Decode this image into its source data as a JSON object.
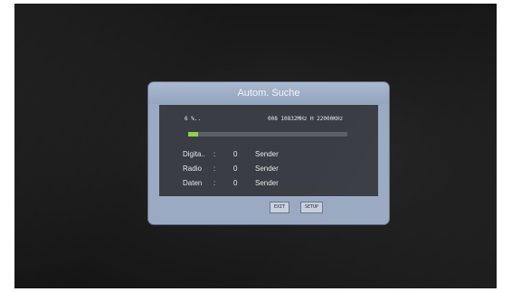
{
  "dialog": {
    "title": "Autom. Suche",
    "progress_text": "6  %..",
    "progress_fraction": 0.06,
    "frequency": "008 10832MHz H 22000KHz",
    "stats": [
      {
        "label": "Digita..",
        "colon": ":",
        "value": "0",
        "unit": "Sender"
      },
      {
        "label": "Radio",
        "colon": ":",
        "value": "0",
        "unit": "Sender"
      },
      {
        "label": "Daten",
        "colon": ":",
        "value": "0",
        "unit": "Sender"
      }
    ],
    "buttons": {
      "exit": "EXIT",
      "setup": "SETUP"
    },
    "colors": {
      "frame": "#9aaac2",
      "panel": "#3a3e44",
      "progress": "#8fd14a"
    }
  }
}
